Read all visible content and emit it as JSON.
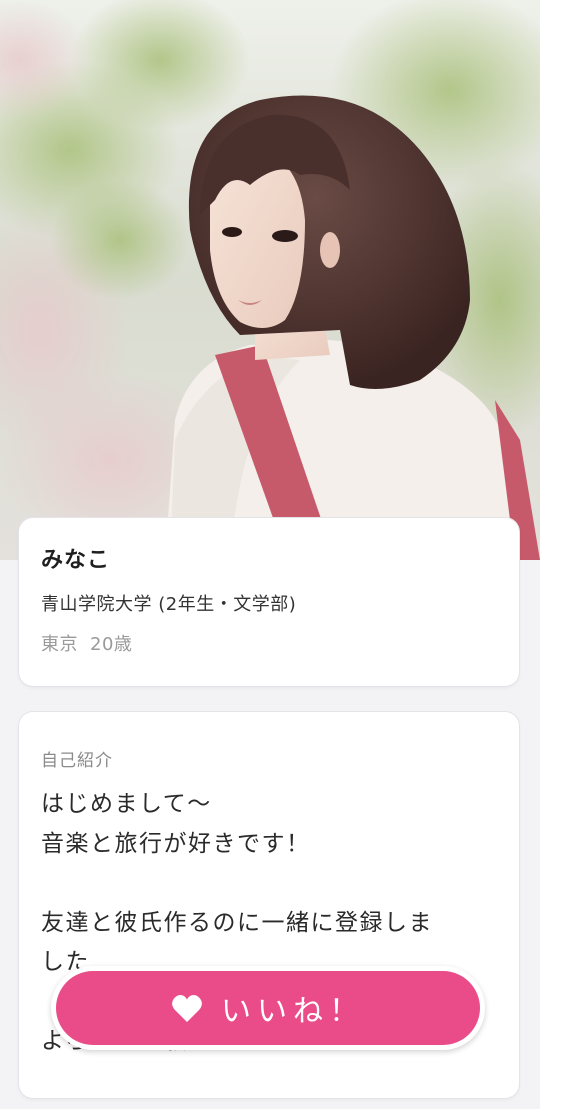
{
  "profile": {
    "name": "みなこ",
    "school": "青山学院大学 (2年生・文学部)",
    "location": "東京",
    "age": "20歳"
  },
  "bio": {
    "heading": "自己紹介",
    "lines": [
      "はじめまして〜",
      "音楽と旅行が好きです！",
      "",
      "友達と彼氏作るのに一緒に登録しま",
      "した",
      "よろしくお願いします！"
    ]
  },
  "like_button": {
    "label": "いいね！",
    "icon": "heart-icon"
  },
  "colors": {
    "accent": "#e94c89",
    "background": "#f3f3f5"
  }
}
